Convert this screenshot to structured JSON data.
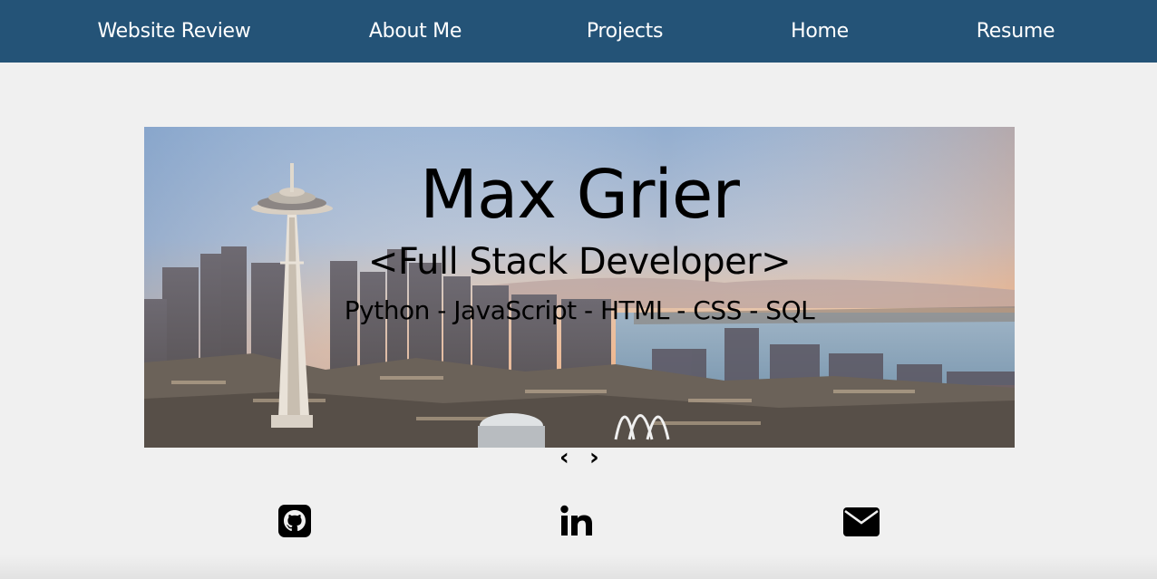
{
  "nav": {
    "items": [
      {
        "label": "Website Review"
      },
      {
        "label": "About Me"
      },
      {
        "label": "Projects"
      },
      {
        "label": "Home"
      },
      {
        "label": "Resume"
      }
    ]
  },
  "hero": {
    "name": "Max Grier",
    "role": "<Full Stack Developer>",
    "skills": "Python - JavaScript - HTML - CSS - SQL"
  },
  "carousel": {
    "prev_label": "‹",
    "next_label": "›"
  },
  "social": {
    "icons": [
      "github-icon",
      "linkedin-icon",
      "envelope-icon"
    ]
  },
  "colors": {
    "nav_bg": "#245377",
    "page_bg": "#f0f0f0",
    "text": "#000000"
  }
}
